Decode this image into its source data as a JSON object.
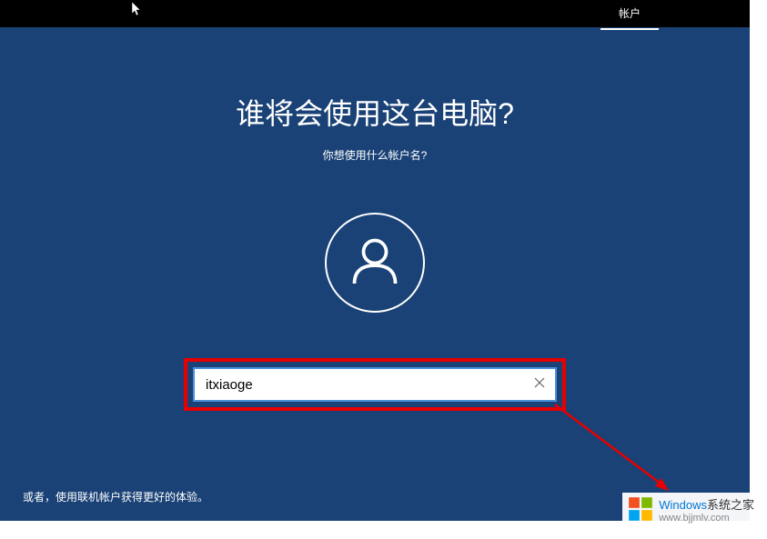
{
  "topbar": {
    "tab_label": "帐户"
  },
  "setup": {
    "title": "谁将会使用这台电脑?",
    "subtitle": "你想使用什么帐户名?",
    "username_value": "itxiaoge",
    "footer_hint": "或者，使用联机帐户获得更好的体验。"
  },
  "watermark": {
    "brand_prefix": "Windows",
    "brand_suffix": "系统之家",
    "url": "www.bjjmlv.com"
  },
  "colors": {
    "background": "#1a4276",
    "highlight": "#e60000",
    "accent": "#0078d7"
  }
}
